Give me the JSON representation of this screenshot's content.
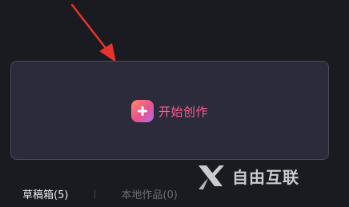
{
  "create_card": {
    "label": "开始创作",
    "icon": "plus-icon",
    "accent_color": "#ff5f8f"
  },
  "tabs": [
    {
      "label": "草稿箱(5)",
      "active": true
    },
    {
      "label": "本地作品(0)",
      "active": false
    }
  ],
  "watermark": {
    "text": "自由互联",
    "icon": "x-logo-icon"
  },
  "annotation": {
    "icon": "red-arrow-icon",
    "color": "#e8322e"
  }
}
